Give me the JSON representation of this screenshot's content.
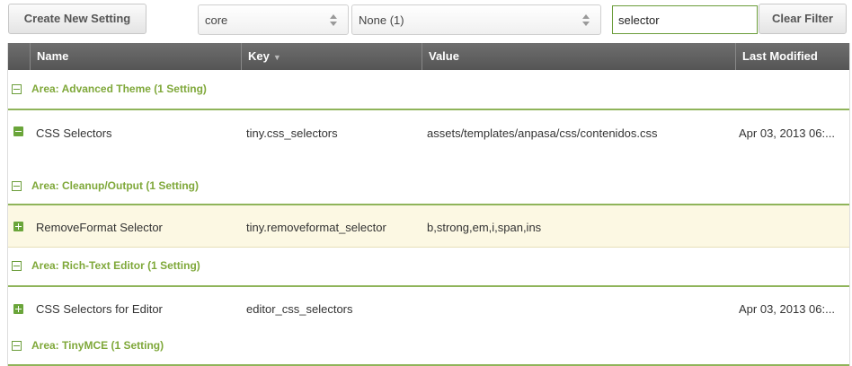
{
  "toolbar": {
    "create_label": "Create New Setting",
    "area_combo": "core",
    "namespace_combo": "None (1)",
    "search_value": "selector",
    "clear_label": "Clear Filter"
  },
  "columns": {
    "name": "Name",
    "key": "Key",
    "value": "Value",
    "modified": "Last Modified"
  },
  "groups": [
    {
      "title": "Area: Advanced Theme (1 Setting)"
    },
    {
      "title": "Area: Cleanup/Output (1 Setting)"
    },
    {
      "title": "Area: Rich-Text Editor (1 Setting)"
    },
    {
      "title": "Area: TinyMCE (1 Setting)"
    }
  ],
  "rows": [
    {
      "name": "CSS Selectors",
      "key": "tiny.css_selectors",
      "value": "assets/templates/anpasa/css/contenidos.css",
      "modified": "Apr 03, 2013 06:..."
    },
    {
      "name": "RemoveFormat Selector",
      "key": "tiny.removeformat_selector",
      "value": "b,strong,em,i,span,ins",
      "modified": ""
    },
    {
      "name": "CSS Selectors for Editor",
      "key": "editor_css_selectors",
      "value": "",
      "modified": "Apr 03, 2013 06:..."
    }
  ],
  "colors": {
    "accent_green": "#7fa83a",
    "header_bg": "#5f5f5f",
    "row_highlight": "#fcf8e3"
  }
}
